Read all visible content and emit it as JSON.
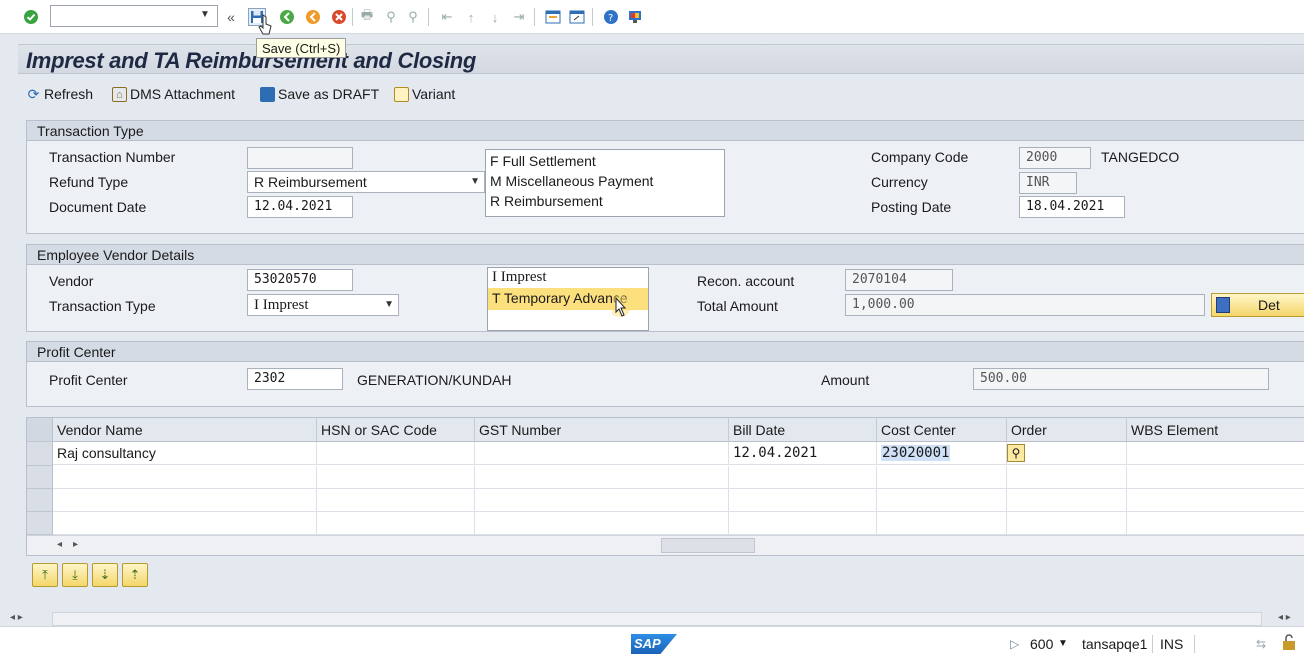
{
  "system_toolbar": {
    "command_field_value": "",
    "tooltip": "Save  (Ctrl+S)"
  },
  "title": "Imprest and TA Reimbursement and Closing",
  "app_toolbar": {
    "refresh": "Refresh",
    "dms": "DMS Attachment",
    "save_draft": "Save as DRAFT",
    "variant": "Variant"
  },
  "transaction_type": {
    "heading": "Transaction Type",
    "transaction_number_label": "Transaction Number",
    "transaction_number_value": "",
    "refund_type_label": "Refund Type",
    "refund_type_value": "R Reimbursement",
    "document_date_label": "Document Date",
    "document_date_value": "12.04.2021",
    "refund_options": [
      "F Full Settlement",
      "M Miscellaneous Payment",
      "R Reimbursement"
    ],
    "company_code_label": "Company Code",
    "company_code_value": "2000",
    "company_name": "TANGEDCO",
    "currency_label": "Currency",
    "currency_value": "INR",
    "posting_date_label": "Posting Date",
    "posting_date_value": "18.04.2021"
  },
  "employee_vendor": {
    "heading": "Employee Vendor Details",
    "vendor_label": "Vendor",
    "vendor_value": "53020570",
    "txn_type_label": "Transaction Type",
    "txn_type_value": "I Imprest",
    "txn_options": [
      "I Imprest",
      "T Temporary Advance"
    ],
    "recon_label": "Recon. account",
    "recon_value": "2070104",
    "total_label": "Total Amount",
    "total_value": "1,000.00",
    "details_button": "Det"
  },
  "profit_center": {
    "heading": "Profit Center",
    "pc_label": "Profit Center",
    "pc_value": "2302",
    "pc_name": "GENERATION/KUNDAH",
    "amount_label": "Amount",
    "amount_value": "500.00"
  },
  "table": {
    "columns": [
      "Vendor Name",
      "HSN or SAC Code",
      "GST Number",
      "Bill Date",
      "Cost Center",
      "Order",
      "WBS Element"
    ],
    "rows": [
      {
        "vendor_name": "Raj consultancy",
        "hsn": "",
        "gst": "",
        "bill_date": "12.04.2021",
        "cost_center": "23020001",
        "order": "",
        "wbs": ""
      }
    ]
  },
  "status_bar": {
    "logo": "SAP",
    "client": "600",
    "server": "tansapqe1",
    "mode": "INS"
  }
}
